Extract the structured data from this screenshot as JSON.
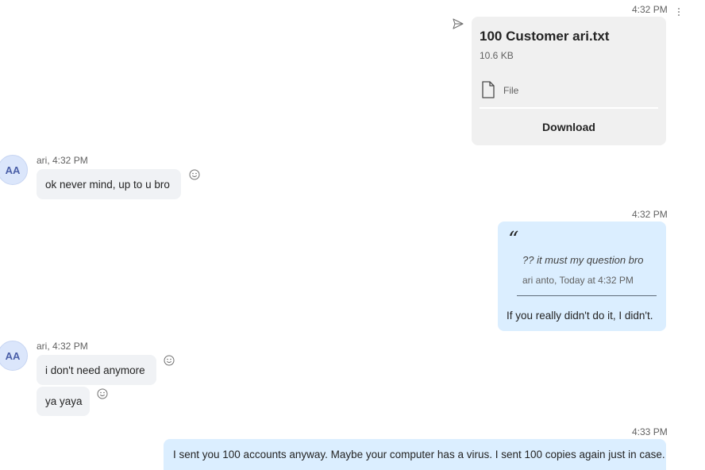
{
  "messages": {
    "file_msg": {
      "time": "4:32 PM",
      "file_name": "100 Customer ari.txt",
      "file_size": "10.6 KB",
      "file_type": "File",
      "download_label": "Download"
    },
    "ari_msg1": {
      "avatar_initials": "AA",
      "sender_time": "ari, 4:32 PM",
      "text": "ok never mind, up to u bro"
    },
    "quote_msg": {
      "time": "4:32 PM",
      "quote_mark": "66",
      "quoted_text": "?? it must my question bro",
      "quoted_meta": "ari anto, Today at 4:32 PM",
      "reply_text": "If you really didn't do it, I didn't."
    },
    "ari_msg2": {
      "avatar_initials": "AA",
      "sender_time": "ari, 4:32 PM",
      "text1": "i don't need anymore",
      "text2": "ya yaya"
    },
    "last_msg": {
      "time": "4:33 PM",
      "text": "I sent you 100 accounts anyway. Maybe your computer has a virus. I sent 100 copies again just in case."
    }
  },
  "icons": {
    "sent": "send-icon",
    "file": "file-icon",
    "react": "smiley-icon",
    "more": "more-options-icon"
  }
}
